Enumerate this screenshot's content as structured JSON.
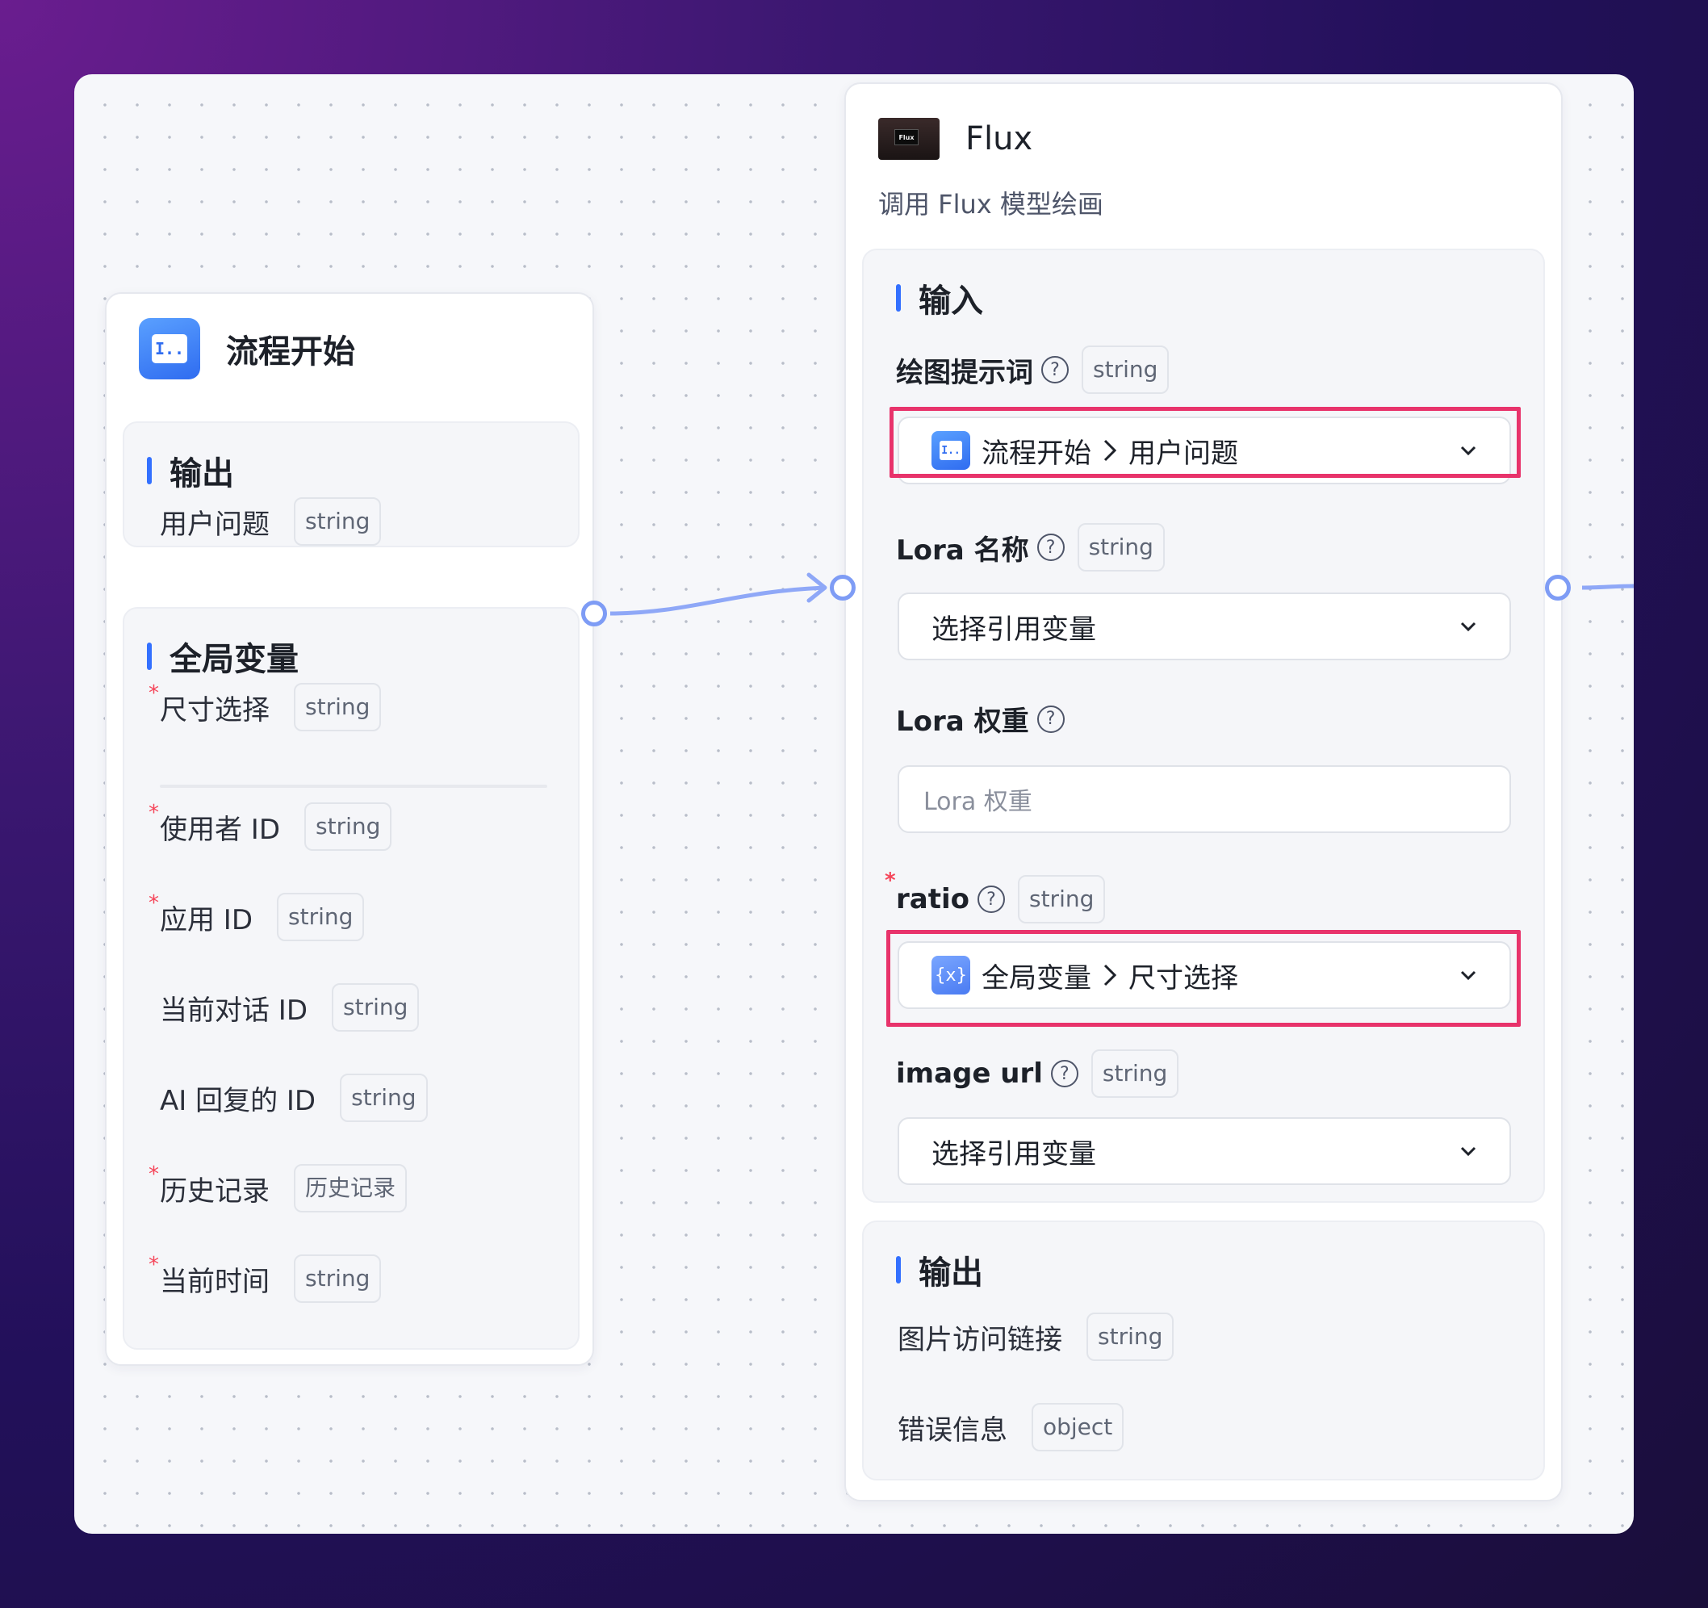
{
  "start_node": {
    "title": "流程开始",
    "output_section": {
      "title": "输出",
      "items": [
        {
          "label": "用户问题",
          "type": "string",
          "required": false
        }
      ]
    },
    "global_section": {
      "title": "全局变量",
      "items": [
        {
          "label": "尺寸选择",
          "type": "string",
          "required": true
        },
        {
          "label": "使用者 ID",
          "type": "string",
          "required": true
        },
        {
          "label": "应用 ID",
          "type": "string",
          "required": true
        },
        {
          "label": "当前对话 ID",
          "type": "string",
          "required": false
        },
        {
          "label": "AI 回复的 ID",
          "type": "string",
          "required": false
        },
        {
          "label": "历史记录",
          "type": "历史记录",
          "required": true
        },
        {
          "label": "当前时间",
          "type": "string",
          "required": true
        }
      ]
    }
  },
  "flux_node": {
    "title": "Flux",
    "thumb_text": "Flux",
    "description": "调用 Flux 模型绘画",
    "input_section": {
      "title": "输入",
      "fields": [
        {
          "label": "绘图提示词",
          "type": "string",
          "required": false,
          "control": "select",
          "ref_icon": "start-node-icon",
          "ref_source": "流程开始",
          "ref_target": "用户问题"
        },
        {
          "label": "Lora 名称",
          "type": "string",
          "required": false,
          "control": "select",
          "placeholder": "选择引用变量"
        },
        {
          "label": "Lora 权重",
          "type": "",
          "required": false,
          "control": "input",
          "placeholder": "Lora 权重"
        },
        {
          "label": "ratio",
          "type": "string",
          "required": true,
          "control": "select",
          "ref_icon": "variable-icon",
          "ref_source": "全局变量",
          "ref_target": "尺寸选择"
        },
        {
          "label": "image url",
          "type": "string",
          "required": false,
          "control": "select",
          "placeholder": "选择引用变量"
        }
      ]
    },
    "output_section": {
      "title": "输出",
      "items": [
        {
          "label": "图片访问链接",
          "type": "string"
        },
        {
          "label": "错误信息",
          "type": "object"
        }
      ]
    }
  },
  "colors": {
    "accent": "#3370ff",
    "highlight": "#e8336b",
    "required_mark": "#f5465a",
    "edge": "#7e9cf5"
  },
  "icons": {
    "start": "start-node-icon",
    "variable": "variable-icon",
    "help": "help-circle-icon",
    "chevron": "chevron-down-icon",
    "separator": "chevron-right-icon"
  },
  "glyphs": {
    "start_icon_text": "I..",
    "variable_icon_text": "{x}",
    "help": "?",
    "required": "*"
  }
}
